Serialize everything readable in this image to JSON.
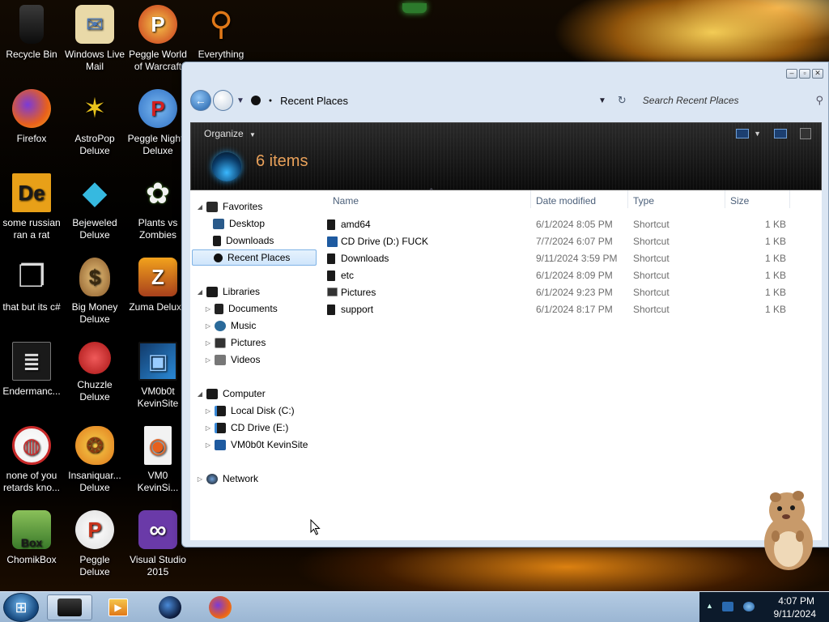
{
  "desktop": {
    "icons": [
      {
        "label": "Recycle Bin",
        "glyph": "",
        "color": "#1d1d1d"
      },
      {
        "label": "Windows Live\nMail",
        "glyph": "✉",
        "color": "#c9a84f"
      },
      {
        "label": "Peggle World\nof Warcraft",
        "glyph": "P",
        "color": "#c8341c"
      },
      {
        "label": "Everything",
        "glyph": "⚲",
        "color": "#e07818"
      },
      {
        "label": "Firefox",
        "glyph": "◉",
        "color": "#e8601c"
      },
      {
        "label": "AstroPop\nDeluxe",
        "glyph": "✶",
        "color": "#d43824"
      },
      {
        "label": "Peggle Nights\nDeluxe",
        "glyph": "P",
        "color": "#2e6fc4"
      },
      {
        "label": "some russian\nran a rat",
        "glyph": "De",
        "color": "#e8a018"
      },
      {
        "label": "Bejeweled\nDeluxe",
        "glyph": "◆",
        "color": "#36b9e0"
      },
      {
        "label": "Plants vs\nZombies",
        "glyph": "✿",
        "color": "#4b8c2a"
      },
      {
        "label": "that but its c#",
        "glyph": "❐",
        "color": "#8a8a8a"
      },
      {
        "label": "Big Money\nDeluxe",
        "glyph": "$",
        "color": "#a8743a"
      },
      {
        "label": "Zuma Deluxe",
        "glyph": "Z",
        "color": "#c6601c"
      },
      {
        "label": "Endermanc...",
        "glyph": "≣",
        "color": "#2a2a2a"
      },
      {
        "label": "Chuzzle\nDeluxe",
        "glyph": "●",
        "color": "#d42020"
      },
      {
        "label": "VM0b0t\nKevinSite",
        "glyph": "▣",
        "color": "#1e5aa0"
      },
      {
        "label": "none of you\nretards kno...",
        "glyph": "◍",
        "color": "#c82a2a"
      },
      {
        "label": "Insaniquar...\nDeluxe",
        "glyph": "❂",
        "color": "#e0901c"
      },
      {
        "label": "VM0\nKevinSi...",
        "glyph": "◉",
        "color": "#5a3aa8"
      },
      {
        "label": "ChomikBox",
        "glyph": "Box",
        "color": "#5a9a3a"
      },
      {
        "label": "Peggle Deluxe",
        "glyph": "P",
        "color": "#c8341c"
      },
      {
        "label": "Visual Studio\n2015",
        "glyph": "∞",
        "color": "#6a3aa8"
      }
    ]
  },
  "explorer": {
    "address": "Recent Places",
    "search_placeholder": "Search Recent Places",
    "organize_label": "Organize",
    "item_count": "6 items",
    "nav": {
      "favorites": "Favorites",
      "desktop": "Desktop",
      "downloads": "Downloads",
      "recent_places": "Recent Places",
      "libraries": "Libraries",
      "documents": "Documents",
      "music": "Music",
      "pictures": "Pictures",
      "videos": "Videos",
      "computer": "Computer",
      "local_disk": "Local Disk (C:)",
      "cd_drive": "CD Drive (E:)",
      "vm_kevinsite": "VM0b0t KevinSite",
      "network": "Network"
    },
    "columns": {
      "name": "Name",
      "date": "Date modified",
      "type": "Type",
      "size": "Size"
    },
    "files": [
      {
        "name": "amd64",
        "date": "6/1/2024 8:05 PM",
        "type": "Shortcut",
        "size": "1 KB"
      },
      {
        "name": "CD Drive (D:) FUCK",
        "date": "7/7/2024 6:07 PM",
        "type": "Shortcut",
        "size": "1 KB"
      },
      {
        "name": "Downloads",
        "date": "9/11/2024 3:59 PM",
        "type": "Shortcut",
        "size": "1 KB"
      },
      {
        "name": "etc",
        "date": "6/1/2024 8:09 PM",
        "type": "Shortcut",
        "size": "1 KB"
      },
      {
        "name": "Pictures",
        "date": "6/1/2024 9:23 PM",
        "type": "Shortcut",
        "size": "1 KB"
      },
      {
        "name": "support",
        "date": "6/1/2024 8:17 PM",
        "type": "Shortcut",
        "size": "1 KB"
      }
    ]
  },
  "taskbar": {
    "clock_time": "4:07 PM",
    "clock_date": "9/11/2024"
  }
}
